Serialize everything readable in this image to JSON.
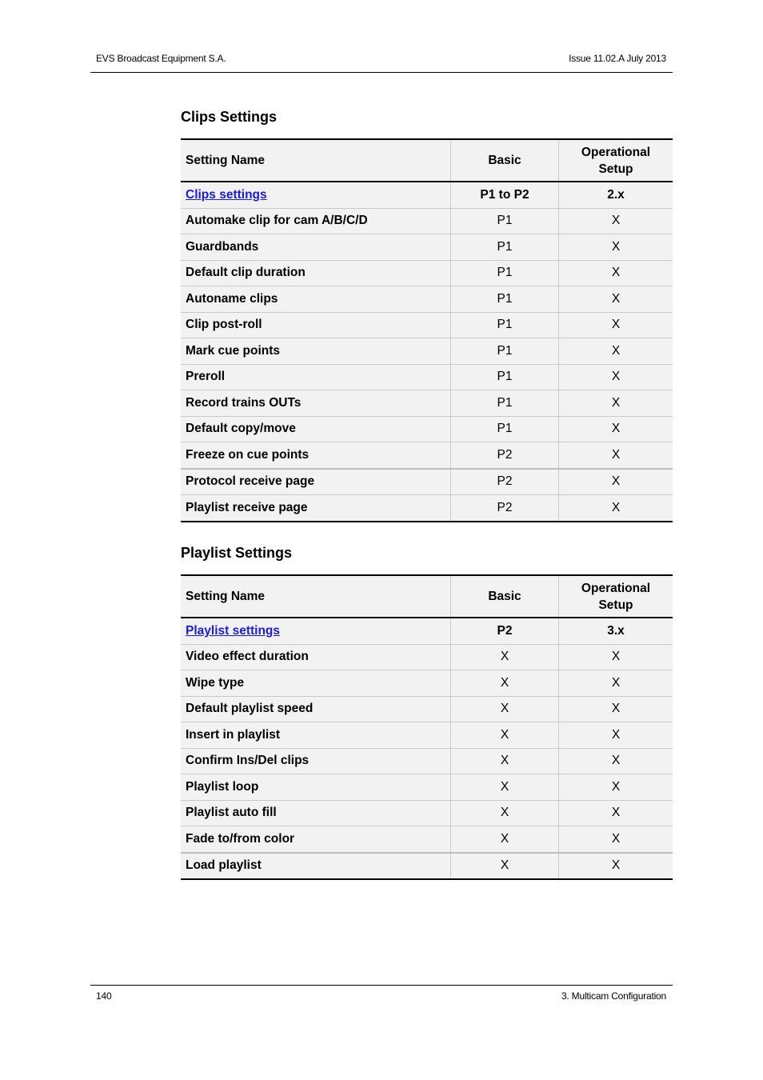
{
  "header": {
    "left": "EVS Broadcast Equipment S.A.",
    "right": "Issue 11.02.A  July 2013"
  },
  "footer": {
    "page_number": "140",
    "chapter": "3. Multicam Configuration"
  },
  "colors": {
    "link": "#1a1ae6",
    "table_bg": "#f2f2f2"
  },
  "clips": {
    "title": "Clips Settings",
    "columns": [
      "Setting Name",
      "Basic",
      "Operational Setup"
    ],
    "summary": {
      "name": "Clips settings",
      "basic": "P1 to P2",
      "operational": "2.x"
    },
    "rows": [
      {
        "name": "Automake clip for cam A/B/C/D",
        "basic": "P1",
        "operational": "X"
      },
      {
        "name": "Guardbands",
        "basic": "P1",
        "operational": "X"
      },
      {
        "name": "Default clip duration",
        "basic": "P1",
        "operational": "X"
      },
      {
        "name": "Autoname clips",
        "basic": "P1",
        "operational": "X"
      },
      {
        "name": "Clip post-roll",
        "basic": "P1",
        "operational": "X"
      },
      {
        "name": "Mark cue points",
        "basic": "P1",
        "operational": "X"
      },
      {
        "name": "Preroll",
        "basic": "P1",
        "operational": "X"
      },
      {
        "name": "Record trains OUTs",
        "basic": "P1",
        "operational": "X"
      },
      {
        "name": "Default copy/move",
        "basic": "P1",
        "operational": "X"
      },
      {
        "name": "Freeze on cue points",
        "basic": "P2",
        "operational": "X"
      },
      {
        "name": "Protocol receive page",
        "basic": "P2",
        "operational": "X"
      },
      {
        "name": "Playlist receive page",
        "basic": "P2",
        "operational": "X"
      }
    ]
  },
  "playlist": {
    "title": "Playlist Settings",
    "columns": [
      "Setting Name",
      "Basic",
      "Operational Setup"
    ],
    "summary": {
      "name": "Playlist settings",
      "basic": "P2",
      "operational": "3.x"
    },
    "rows": [
      {
        "name": "Video effect duration",
        "basic": "X",
        "operational": "X"
      },
      {
        "name": "Wipe type",
        "basic": "X",
        "operational": "X"
      },
      {
        "name": "Default playlist speed",
        "basic": "X",
        "operational": "X"
      },
      {
        "name": "Insert in playlist",
        "basic": "X",
        "operational": "X"
      },
      {
        "name": "Confirm Ins/Del clips",
        "basic": "X",
        "operational": "X"
      },
      {
        "name": "Playlist loop",
        "basic": "X",
        "operational": "X"
      },
      {
        "name": "Playlist auto fill",
        "basic": "X",
        "operational": "X"
      },
      {
        "name": "Fade to/from color",
        "basic": "X",
        "operational": "X"
      },
      {
        "name": "Load playlist",
        "basic": "X",
        "operational": "X"
      }
    ]
  }
}
